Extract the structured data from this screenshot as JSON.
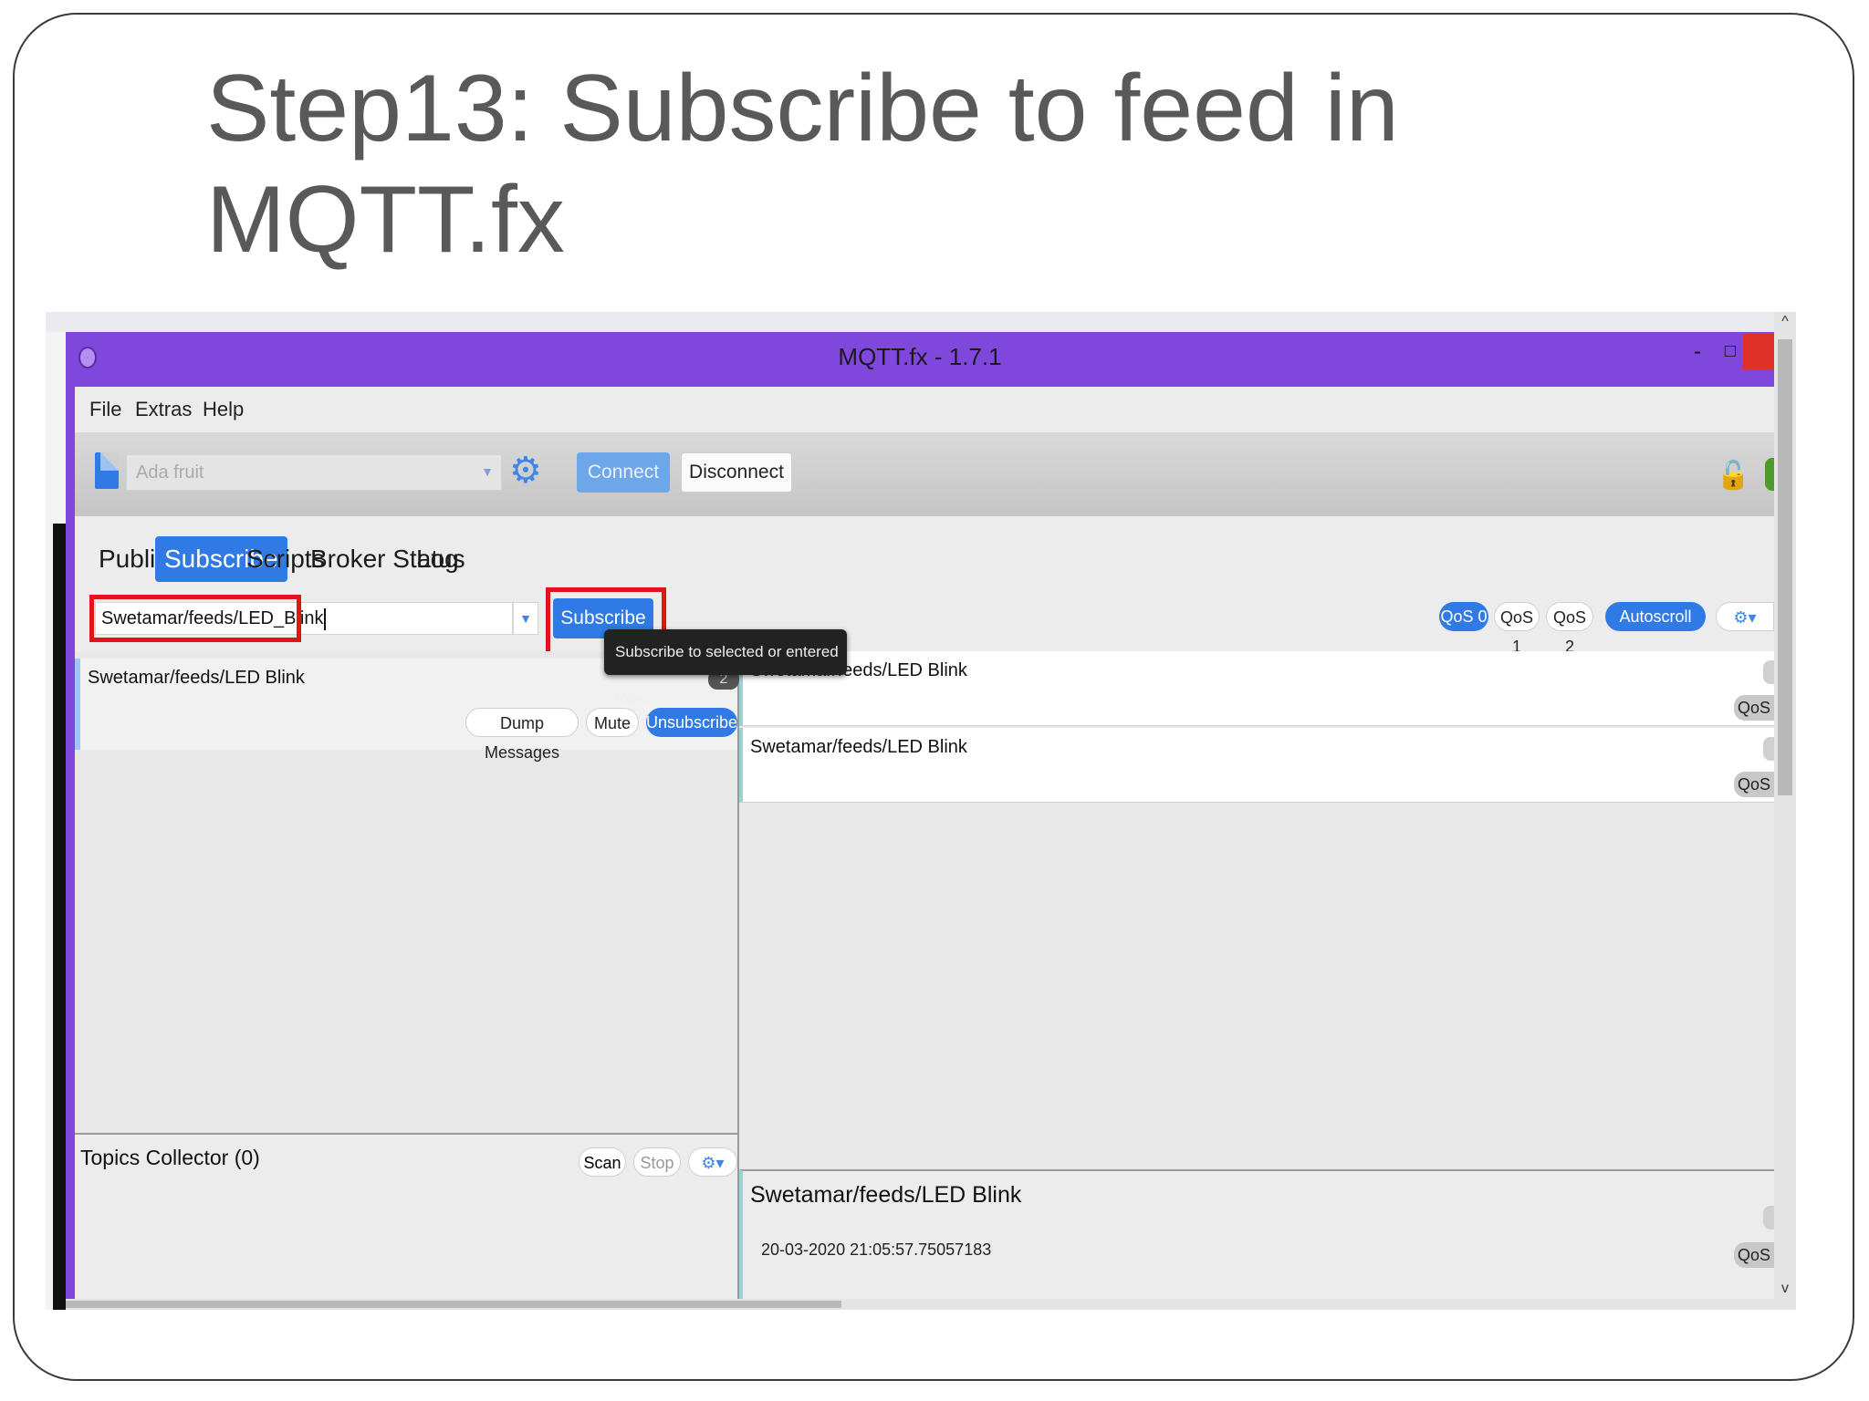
{
  "slide": {
    "title_line1": "Step13: Subscribe to feed in",
    "title_line2": "MQTT.fx"
  },
  "window": {
    "title": "MQTT.fx - 1.7.1",
    "minimize_label": "-",
    "maximize_label": "□",
    "close_label": "×"
  },
  "menu": [
    "File",
    "Extras",
    "Help"
  ],
  "toolbar": {
    "profile": "Ada fruit",
    "connect_label": "Connect",
    "disconnect_label": "Disconnect"
  },
  "tabs": [
    "Publish",
    "Subscribe",
    "Scripts",
    "Broker Status",
    "Log"
  ],
  "subscribe_bar": {
    "topic_value": "Swetamar/feeds/LED_Blink",
    "subscribe_label": "Subscribe",
    "tooltip": "Subscribe to selected or entered topic.",
    "qos0": "QoS 0",
    "qos1": "QoS 1",
    "qos2": "QoS 2",
    "autoscroll": "Autoscroll"
  },
  "subscriptions": [
    {
      "topic": "Swetamar/feeds/LED Blink",
      "count": "2",
      "dump_label": "Dump Messages",
      "mute_label": "Mute",
      "unsubscribe_label": "Unsubscribe"
    }
  ],
  "topics_collector": {
    "title": "Topics Collector (0)",
    "scan_label": "Scan",
    "stop_label": "Stop"
  },
  "messages": [
    {
      "topic": "Swetamar/feeds/LED Blink",
      "qos": "QoS"
    },
    {
      "topic": "Swetamar/feeds/LED Blink",
      "qos": "QoS"
    }
  ],
  "detail": {
    "topic": "Swetamar/feeds/LED Blink",
    "timestamp": "20-03-2020 21:05:57.75057183",
    "qos": "QoS"
  },
  "colors": {
    "titlebar": "#8047dd",
    "accent": "#2f7ae5",
    "highlight_box": "#e0141b"
  }
}
